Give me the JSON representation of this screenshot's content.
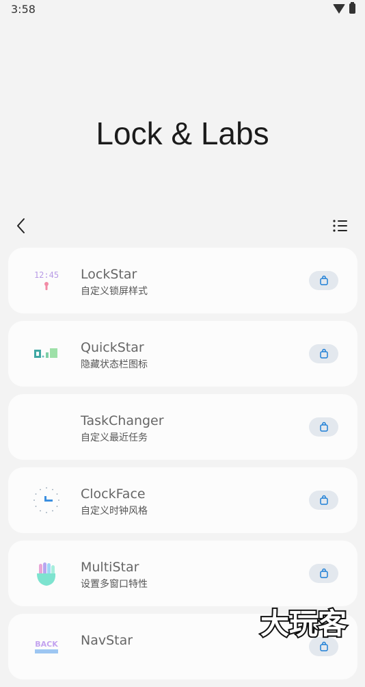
{
  "status": {
    "time": "3:58"
  },
  "header": {
    "title": "Lock & Labs"
  },
  "apps": [
    {
      "name": "LockStar",
      "desc": "自定义锁屏样式",
      "icon_text": "12:45"
    },
    {
      "name": "QuickStar",
      "desc": "隐藏状态栏图标"
    },
    {
      "name": "TaskChanger",
      "desc": "自定义最近任务"
    },
    {
      "name": "ClockFace",
      "desc": "自定义时钟风格"
    },
    {
      "name": "MultiStar",
      "desc": "设置多窗口特性"
    },
    {
      "name": "NavStar",
      "desc": "",
      "icon_text": "BACK"
    }
  ],
  "watermark": {
    "text": "大玩客"
  },
  "colors": {
    "accent": "#1e7fd6",
    "card": "#fcfcfc",
    "background": "#f3f3f3"
  }
}
